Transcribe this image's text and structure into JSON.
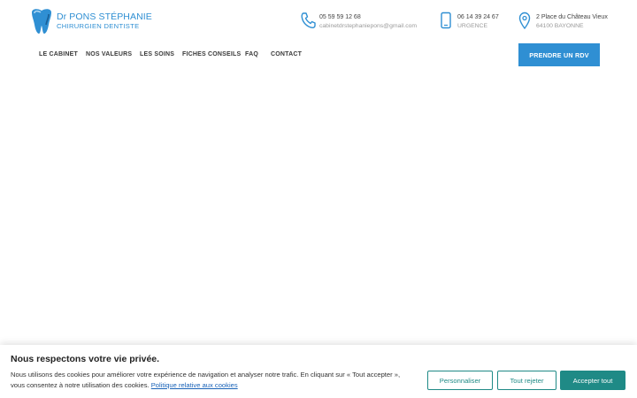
{
  "logo": {
    "name": "Dr PONS STÉPHANIE",
    "subtitle": "CHIRURGIEN DENTISTE",
    "icon": "tooth-icon"
  },
  "contacts": [
    {
      "icon": "phone-icon",
      "line1": "05 59 59 12 68",
      "line2": "cabinetdrstephaniepons@gmail.com"
    },
    {
      "icon": "mobile-phone-icon",
      "line1": "06 14 39 24 67",
      "line2": "URGENCE"
    },
    {
      "icon": "map-pin-icon",
      "line1": "2 Place du Château Vieux",
      "line2": "64100 BAYONNE"
    }
  ],
  "nav": {
    "items": [
      "LE CABINET",
      "NOS VALEURS",
      "LES SOINS",
      "FICHES CONSEILS",
      "FAQ",
      "CONTACT"
    ]
  },
  "cta": {
    "label": "PRENDRE UN RDV"
  },
  "cookie_banner": {
    "title": "Nous respectons votre vie privée.",
    "text": "Nous utilisons des cookies pour améliorer votre expérience de navigation et analyser notre trafic. En cliquant sur « Tout accepter », vous consentez à notre utilisation des cookies.",
    "link": "Politique relative aux cookies",
    "buttons": {
      "customize": "Personnaliser",
      "reject": "Tout rejeter",
      "accept": "Accepter tout"
    }
  },
  "colors": {
    "brand_blue": "#2f8fd3",
    "cookie_teal": "#1f8a86"
  }
}
